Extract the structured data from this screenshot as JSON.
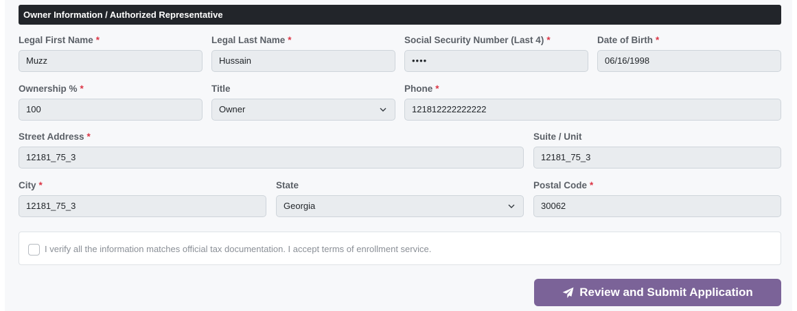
{
  "section": {
    "title": "Owner Information / Authorized Representative"
  },
  "fields": {
    "first_name": {
      "label": "Legal First Name",
      "required": "*",
      "value": "Muzz"
    },
    "last_name": {
      "label": "Legal Last Name",
      "required": "*",
      "value": "Hussain"
    },
    "ssn_last4": {
      "label": "Social Security Number (Last 4)",
      "required": "*",
      "value": "••••"
    },
    "dob": {
      "label": "Date of Birth",
      "required": "*",
      "value": "06/16/1998"
    },
    "ownership": {
      "label": "Ownership %",
      "required": "*",
      "value": "100"
    },
    "title": {
      "label": "Title",
      "value": "Owner"
    },
    "phone": {
      "label": "Phone",
      "required": "*",
      "value": "121812222222222"
    },
    "street": {
      "label": "Street Address",
      "required": "*",
      "value": "12181_75_3"
    },
    "suite": {
      "label": "Suite / Unit",
      "value": "12181_75_3"
    },
    "city": {
      "label": "City",
      "required": "*",
      "value": "12181_75_3"
    },
    "state": {
      "label": "State",
      "value": "Georgia"
    },
    "postal": {
      "label": "Postal Code",
      "required": "*",
      "value": "30062"
    }
  },
  "verify": {
    "text": "I verify all the information matches official tax documentation. I accept terms of enrollment service.",
    "checked": false
  },
  "submit": {
    "label": "Review and Submit Application",
    "icon": "paper-plane-icon"
  },
  "colors": {
    "header_bg": "#22252a",
    "required": "#dc3545",
    "button": "#7b6398",
    "input_bg": "#e9ecef"
  }
}
